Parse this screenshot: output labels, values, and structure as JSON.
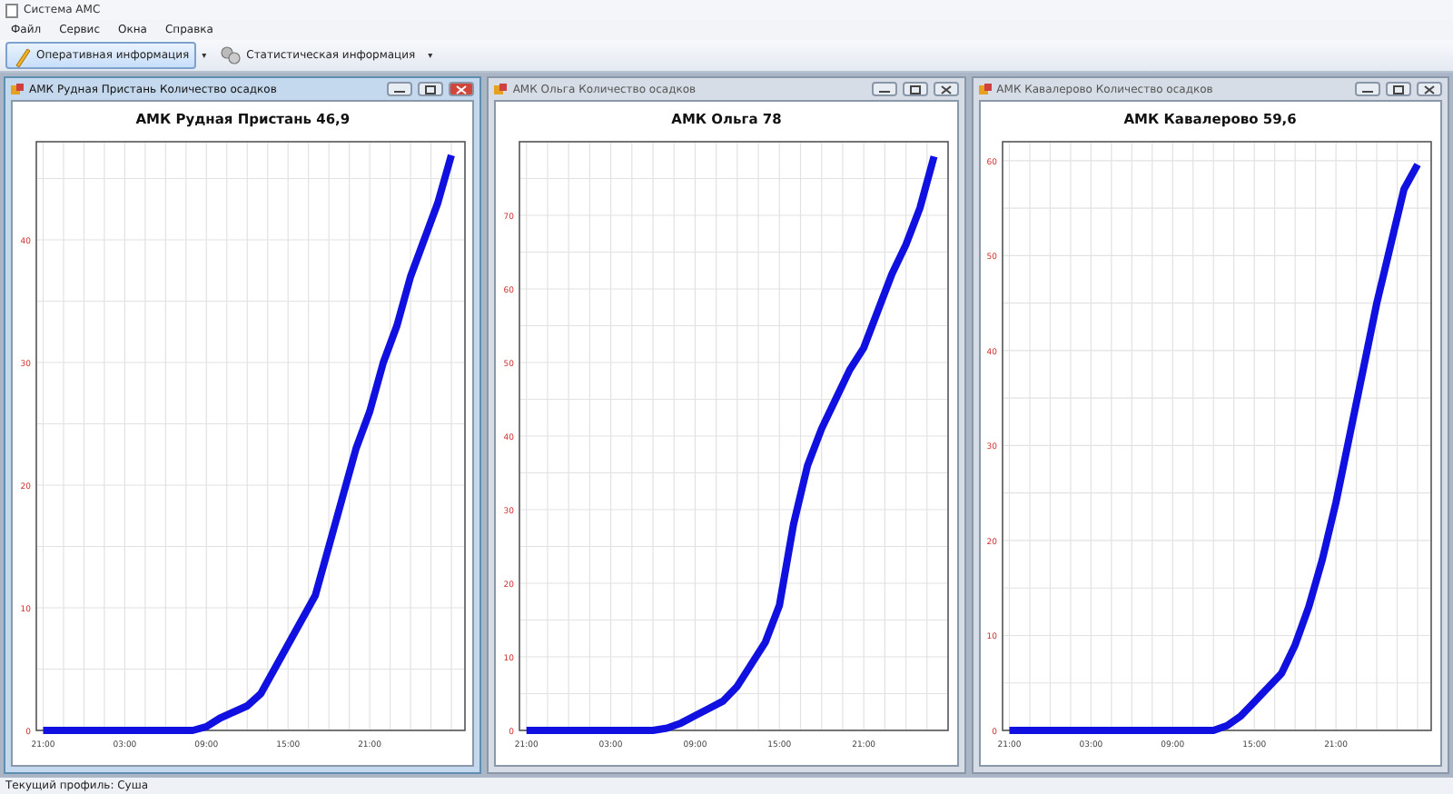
{
  "window": {
    "title": "Система АМС"
  },
  "menu": [
    "Файл",
    "Сервис",
    "Окна",
    "Справка"
  ],
  "toolbar": [
    {
      "label": "Оперативная информация",
      "selected": true,
      "dropdown": "▾"
    },
    {
      "label": "Статистическая информация",
      "selected": false,
      "dropdown": "▾"
    }
  ],
  "charts": [
    {
      "window_title": "АМК Рудная Пристань Количество осадков",
      "active": true,
      "chart_data": {
        "type": "line",
        "title": "АМК Рудная Пристань 46,9",
        "categories": [
          "21:00",
          null,
          null,
          null,
          null,
          null,
          "03:00",
          null,
          null,
          null,
          null,
          null,
          "09:00",
          null,
          null,
          null,
          null,
          null,
          "15:00",
          null,
          null,
          null,
          null,
          null,
          "21:00",
          null,
          null,
          null,
          null,
          null,
          null
        ],
        "series": [
          {
            "color": "#1010e0",
            "values": [
              0,
              0,
              0,
              0,
              0,
              0,
              0,
              0,
              0,
              0,
              0,
              0,
              0.3,
              1,
              1.5,
              2,
              3,
              5,
              7,
              9,
              11,
              15,
              19,
              23,
              26,
              30,
              33,
              37,
              40,
              43,
              46.9
            ]
          }
        ],
        "grid": true,
        "ylim": [
          0,
          48
        ],
        "yticks": [
          0,
          10,
          20,
          30,
          40
        ]
      }
    },
    {
      "window_title": "АМК Ольга Количество осадков",
      "active": false,
      "chart_data": {
        "type": "line",
        "title": "АМК Ольга 78",
        "categories": [
          "21:00",
          null,
          null,
          null,
          null,
          null,
          "03:00",
          null,
          null,
          null,
          null,
          null,
          "09:00",
          null,
          null,
          null,
          null,
          null,
          "15:00",
          null,
          null,
          null,
          null,
          null,
          "21:00",
          null,
          null,
          null,
          null,
          null
        ],
        "series": [
          {
            "color": "#1010e0",
            "values": [
              0,
              0,
              0,
              0,
              0,
              0,
              0,
              0,
              0,
              0,
              0.3,
              1,
              2,
              3,
              4,
              6,
              9,
              12,
              17,
              28,
              36,
              41,
              45,
              49,
              52,
              57,
              62,
              66,
              71,
              78
            ]
          }
        ],
        "grid": true,
        "ylim": [
          0,
          80
        ],
        "yticks": [
          0,
          10,
          20,
          30,
          40,
          50,
          60,
          70
        ]
      }
    },
    {
      "window_title": "АМК Кавалерово Количество осадков",
      "active": false,
      "chart_data": {
        "type": "line",
        "title": "АМК Кавалерово 59,6",
        "categories": [
          "21:00",
          null,
          null,
          null,
          null,
          null,
          "03:00",
          null,
          null,
          null,
          null,
          null,
          "09:00",
          null,
          null,
          null,
          null,
          null,
          "15:00",
          null,
          null,
          null,
          null,
          null,
          "21:00",
          null,
          null,
          null,
          null,
          null,
          null
        ],
        "series": [
          {
            "color": "#1010e0",
            "values": [
              0,
              0,
              0,
              0,
              0,
              0,
              0,
              0,
              0,
              0,
              0,
              0,
              0,
              0,
              0,
              0,
              0.5,
              1.5,
              3,
              4.5,
              6,
              9,
              13,
              18,
              24,
              31,
              38,
              45,
              51,
              57,
              59.6
            ]
          }
        ],
        "grid": true,
        "ylim": [
          0,
          62
        ],
        "yticks": [
          0,
          10,
          20,
          30,
          40,
          50,
          60
        ]
      }
    }
  ],
  "status_bar": "Текущий профиль: Суша"
}
